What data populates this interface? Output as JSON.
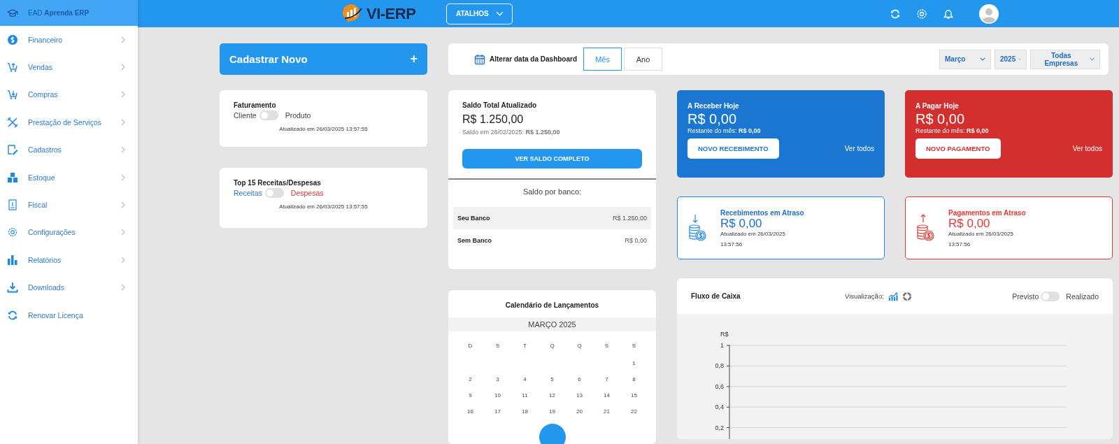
{
  "sidebar": {
    "header": "EAD **Aprenda ERP**",
    "items": [
      {
        "label": "Financeiro",
        "expandable": true
      },
      {
        "label": "Vendas",
        "expandable": true
      },
      {
        "label": "Compras",
        "expandable": true
      },
      {
        "label": "Prestação de Serviços",
        "expandable": true
      },
      {
        "label": "Cadastros",
        "expandable": true
      },
      {
        "label": "Estoque",
        "expandable": true
      },
      {
        "label": "Fiscal",
        "expandable": true
      },
      {
        "label": "Configurações",
        "expandable": true
      },
      {
        "label": "Relatórios",
        "expandable": true
      },
      {
        "label": "Downloads",
        "expandable": true
      },
      {
        "label": "Renovar Licença",
        "expandable": false
      }
    ]
  },
  "topbar": {
    "logo": "VI-ERP",
    "shortcuts": "ATALHOS"
  },
  "create_new": {
    "label": "Cadastrar Novo",
    "icon": "+"
  },
  "date_bar": {
    "label": "Alterar data da Dashboard",
    "periods": [
      {
        "label": "Mês",
        "selected": true
      },
      {
        "label": "Ano",
        "selected": false
      }
    ],
    "selects": [
      {
        "value": "Março"
      },
      {
        "value": "2025"
      },
      {
        "value": "Todas Empresas"
      }
    ]
  },
  "billing": {
    "title": "Faturamento",
    "left": "Cliente",
    "right": "Produto",
    "on": false,
    "updated": "Atualizado em 26/03/2025 13:57:55"
  },
  "top15": {
    "title": "Top 15 Receitas/Despesas",
    "left": "Receitas",
    "right": "Despesas",
    "on": false,
    "updated": "Atualizado em 26/03/2025 13:57:55"
  },
  "balance": {
    "title": "Saldo Total Atualizado",
    "amount": "R$ 1.250,00",
    "previous": "Saldo em 26/02/2025: **R$ 1.250,00**",
    "button": "VER SALDO COMPLETO",
    "banks_title": "Saldo por banco:",
    "banks": [
      {
        "name": "Seu Banco",
        "amount": "R$ 1.250,00"
      },
      {
        "name": "Sem Banco",
        "amount": "R$ 0,00"
      }
    ]
  },
  "today_cards": [
    {
      "kind": "receivable",
      "title": "A Receber Hoje",
      "amount": "R$ 0,00",
      "remaining": "Restante do mês: **R$ 0,00**",
      "button": "NOVO RECEBIMENTO",
      "link": "Ver todos"
    },
    {
      "kind": "payable",
      "title": "A Pagar Hoje",
      "amount": "R$ 0,00",
      "remaining": "Restante do mês: **R$ 0,00**",
      "button": "NOVO PAGAMENTO",
      "link": "Ver todos"
    }
  ],
  "overdue_cards": [
    {
      "kind": "receivable",
      "title": "Recebimentos em Atraso",
      "amount": "R$ 0,00",
      "updated": "Atualizado em 26/03/2025",
      "time": "13:57:56"
    },
    {
      "kind": "payable",
      "title": "Pagamentos em Atraso",
      "amount": "R$ 0,00",
      "updated": "Atualizado em 26/03/2025",
      "time": "13:57:56"
    }
  ],
  "calendar": {
    "title": "Calendário de Lançamentos",
    "month": "MARÇO 2025",
    "weekdays": [
      "D",
      "S",
      "T",
      "Q",
      "Q",
      "S",
      "S"
    ],
    "weeks": [
      [
        "1"
      ],
      [
        "2",
        "3",
        "4",
        "5",
        "6",
        "7",
        "8"
      ],
      [
        "9",
        "10",
        "11",
        "12",
        "13",
        "14",
        "15"
      ],
      [
        "16",
        "17",
        "18",
        "19",
        "20",
        "21",
        "22"
      ]
    ]
  },
  "cash_flow": {
    "title": "Fluxo de Caixa",
    "view_label": "Visualização:",
    "left": "Previsto",
    "right": "Realizado",
    "on": false,
    "chart": {
      "axis_label": "R$",
      "tick_labels": [
        "1",
        "0,8",
        "0,6",
        "0,4",
        "0,2"
      ]
    }
  }
}
